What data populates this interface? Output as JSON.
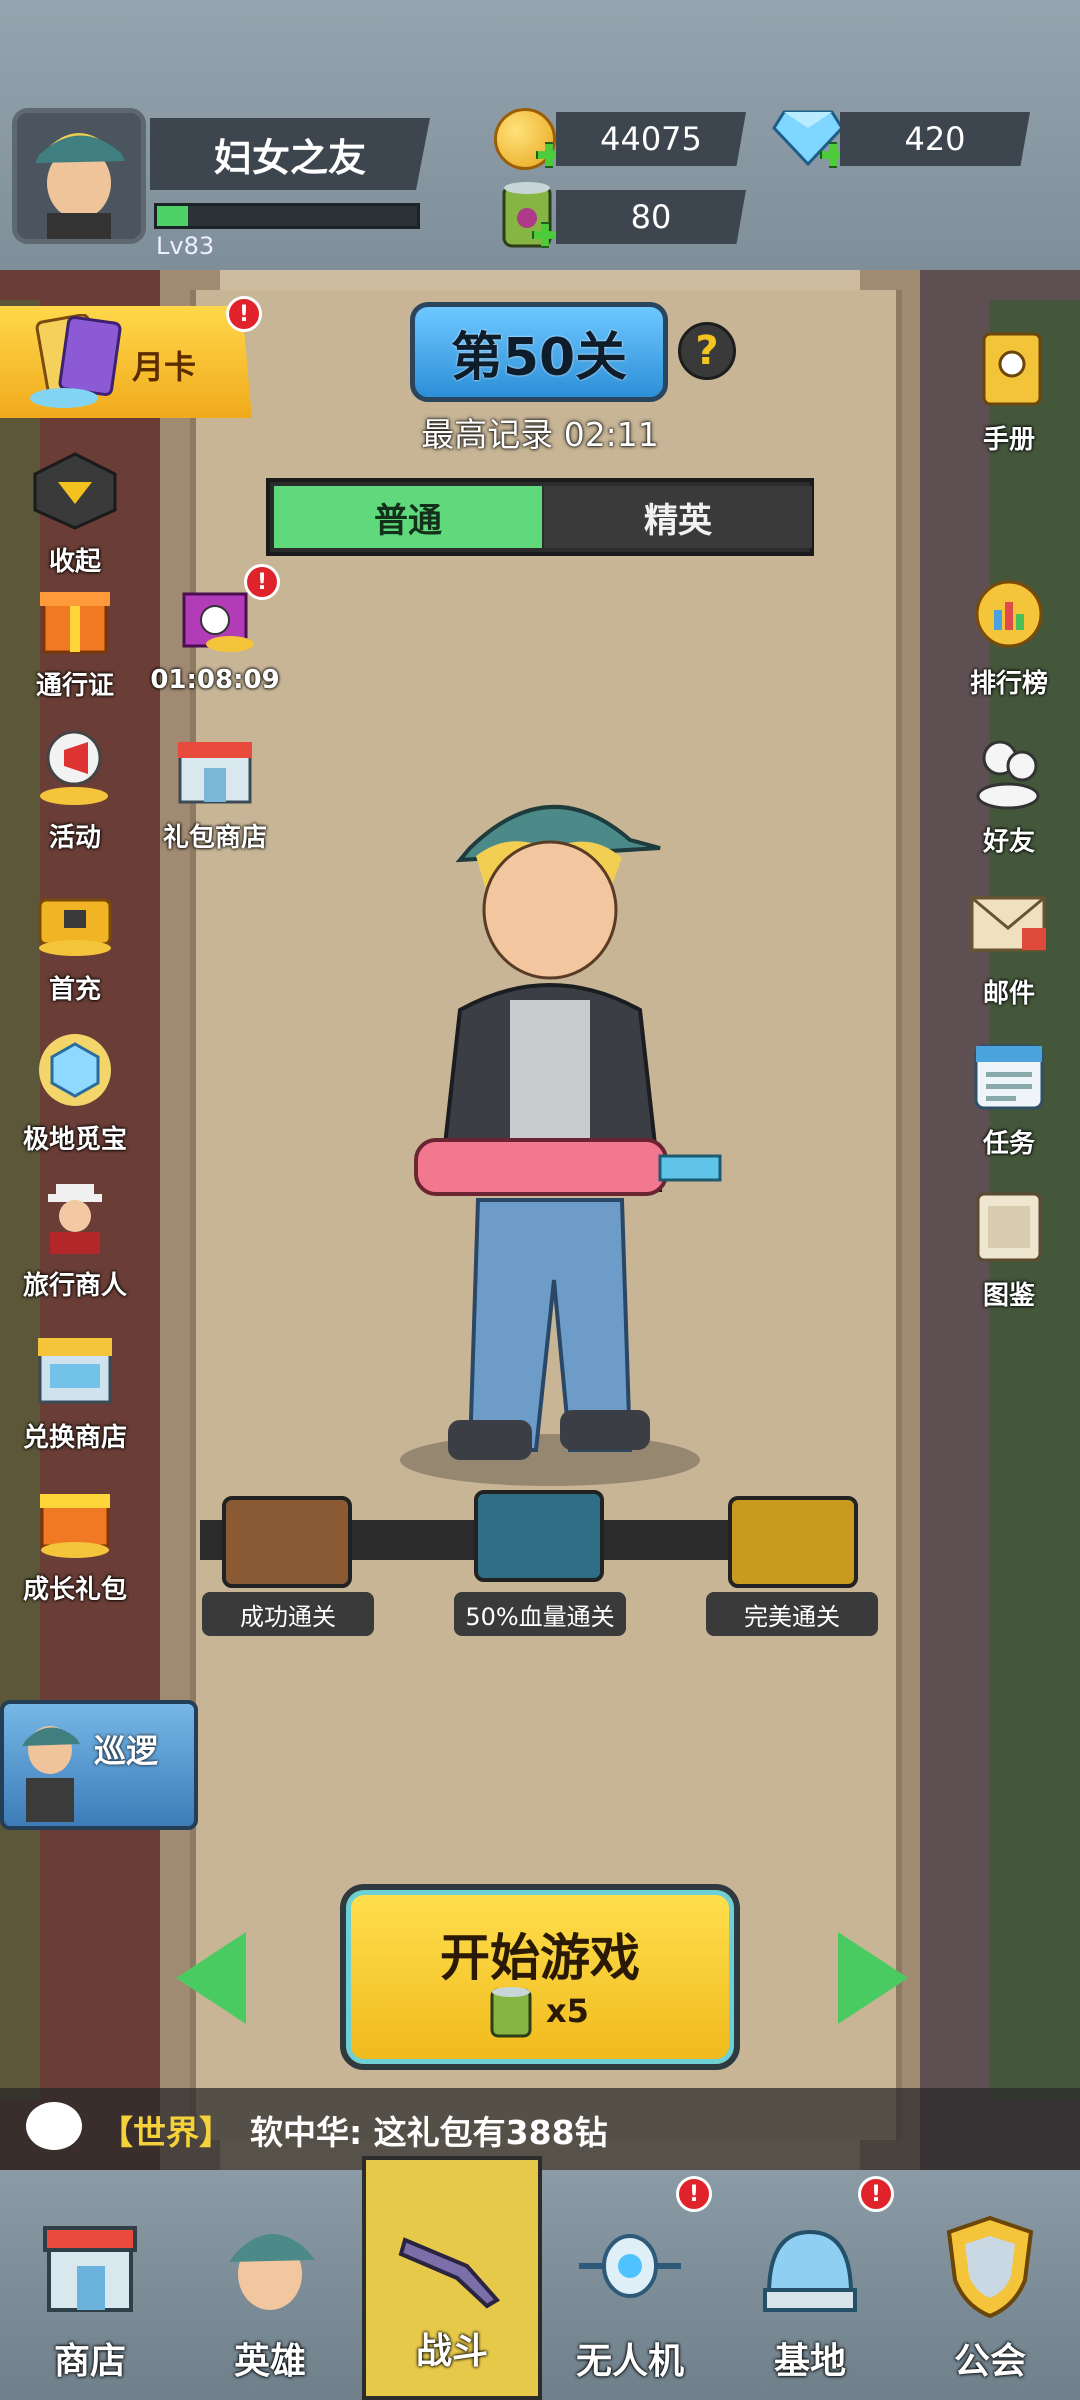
{
  "player": {
    "name": "妇女之友",
    "level": "Lv83",
    "xp_fraction": 0.12
  },
  "resources": {
    "gold": "44075",
    "diamonds": "420",
    "stamina": "80"
  },
  "stage": {
    "title": "第50关",
    "record": "最高记录 02:11",
    "help": "?"
  },
  "difficulty": {
    "normal": "普通",
    "elite": "精英",
    "selected": "普通"
  },
  "left_menu": {
    "month_card": "月卡",
    "collapse": "收起",
    "pass": "通行证",
    "timer": "01:08:09",
    "activity": "活动",
    "gift_shop": "礼包商店",
    "first_charge": "首充",
    "polar_treasure": "极地觅宝",
    "travel_merchant": "旅行商人",
    "exchange_shop": "兑换商店",
    "growth_gift": "成长礼包",
    "patrol": "巡逻"
  },
  "right_menu": {
    "manual": "手册",
    "leaderboard": "排行榜",
    "friends": "好友",
    "mail": "邮件",
    "tasks": "任务",
    "codex": "图鉴"
  },
  "alerts": {
    "badge": "!"
  },
  "rewards": [
    {
      "label": "成功通关",
      "color": "#8a5a34"
    },
    {
      "label": "50%血量通关",
      "color": "#2f6f86"
    },
    {
      "label": "完美通关",
      "color": "#c99a1e"
    }
  ],
  "start": {
    "label": "开始游戏",
    "cost": "x5"
  },
  "chat": {
    "channel": "【世界】",
    "message": "软中华: 这礼包有388钻"
  },
  "nav": {
    "shop": "商店",
    "heroes": "英雄",
    "battle": "战斗",
    "drone": "无人机",
    "base": "基地",
    "guild": "公会",
    "active": "战斗"
  }
}
